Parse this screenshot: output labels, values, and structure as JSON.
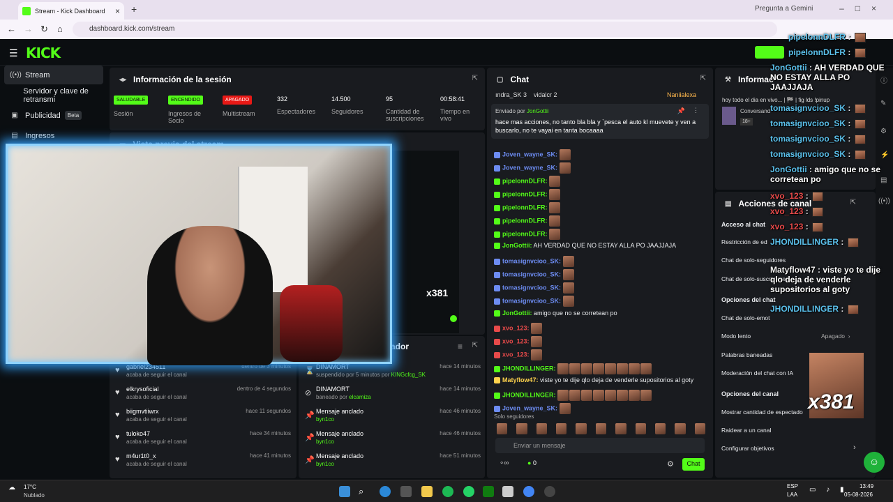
{
  "browser": {
    "tab_title": "Stream - Kick Dashboard",
    "url": "dashboard.kick.com/stream",
    "gemini": "Pregunta a Gemini"
  },
  "kick": {
    "logo": "KICK"
  },
  "sidebar": {
    "items": [
      {
        "label": "Stream",
        "icon": "broadcast-icon"
      },
      {
        "label": "Servidor y clave de retransmi",
        "icon": ""
      },
      {
        "label": "Publicidad",
        "icon": "megaphone-icon",
        "badge": "Beta"
      },
      {
        "label": "Ingresos",
        "icon": "bars-icon"
      }
    ]
  },
  "session": {
    "title": "Información de la sesión",
    "stats": [
      {
        "badge": "SALUDABLE",
        "label": "Sesión"
      },
      {
        "badge": "ENCENDIDO",
        "label": "Ingresos de Socio"
      },
      {
        "badge": "APAGADO",
        "label": "Multistream"
      },
      {
        "value": "332",
        "label": "Espectadores"
      },
      {
        "value": "14.500",
        "label": "Seguidores"
      },
      {
        "value": "95",
        "label": "Cantidad de suscripciones"
      },
      {
        "value": "00:58:41",
        "label": "Tiempo en vivo"
      }
    ]
  },
  "preview": {
    "title": "Vista previa del stream",
    "overlay_text": "x381"
  },
  "followers": [
    {
      "name": "gabriel234511",
      "sub": "acaba de seguir el canal",
      "time": "dentro de 3 minutos"
    },
    {
      "name": "elkrysoficial",
      "sub": "acaba de seguir el canal",
      "time": "dentro de 4 segundos"
    },
    {
      "name": "biigmvtiiwrx",
      "sub": "acaba de seguir el canal",
      "time": "hace 11 segundos"
    },
    {
      "name": "tuloko47",
      "sub": "acaba de seguir el canal",
      "time": "hace 34 minutos"
    },
    {
      "name": "m4ur1t0_x",
      "sub": "acaba de seguir el canal",
      "time": "hace 41 minutos"
    }
  ],
  "moderation": {
    "title_partial": "ador",
    "items": [
      {
        "name": "DINAMORT",
        "sub": "suspendido por 5 minutos por",
        "by": "KINGcfcg_SK",
        "time": "hace 14 minutos"
      },
      {
        "name": "DINAMORT",
        "sub": "baneado por",
        "by": "elcamiza",
        "time": "hace 14 minutos"
      },
      {
        "name": "Mensaje anclado",
        "sub": "",
        "by": "byn1co",
        "time": "hace 46 minutos"
      },
      {
        "name": "Mensaje anclado",
        "sub": "",
        "by": "byn1co",
        "time": "hace 46 minutos"
      },
      {
        "name": "Mensaje anclado",
        "sub": "",
        "by": "byn1co",
        "time": "hace 51 minutos"
      }
    ]
  },
  "chat": {
    "title": "Chat",
    "top_users": [
      "ındra_SK 3",
      "vidalcr 2",
      "Naniialexa"
    ],
    "pinned_by_label": "Enviado por",
    "pinned_user": "JonGottii",
    "pinned_text": "hace mas acciones, no tanto bla bla y `pesca el auto kl muevete y ven a buscarlo, no te vayai en tanta bocaaaa",
    "messages": [
      {
        "user": "Joven_wayne_SK:",
        "text": "",
        "color": "#6d8cf2"
      },
      {
        "user": "Joven_wayne_SK:",
        "text": "",
        "color": "#6d8cf2"
      },
      {
        "user": "pipelonnDLFR:",
        "text": "",
        "color": "#53fc18"
      },
      {
        "user": "pipelonnDLFR:",
        "text": "",
        "color": "#53fc18"
      },
      {
        "user": "pipelonnDLFR:",
        "text": "",
        "color": "#53fc18"
      },
      {
        "user": "pipelonnDLFR:",
        "text": "",
        "color": "#53fc18"
      },
      {
        "user": "pipelonnDLFR:",
        "text": "",
        "color": "#53fc18"
      },
      {
        "user": "JonGottii:",
        "text": "AH VERDAD QUE NO ESTAY ALLA PO JAAJJAJA",
        "color": "#53fc18"
      },
      {
        "user": "tomasignvcioo_SK:",
        "text": "",
        "color": "#6d8cf2"
      },
      {
        "user": "tomasignvcioo_SK:",
        "text": "",
        "color": "#6d8cf2"
      },
      {
        "user": "tomasignvcioo_SK:",
        "text": "",
        "color": "#6d8cf2"
      },
      {
        "user": "tomasignvcioo_SK:",
        "text": "",
        "color": "#6d8cf2"
      },
      {
        "user": "JonGottii:",
        "text": "amigo que no se corretean po",
        "color": "#53fc18"
      },
      {
        "user": "xvo_123:",
        "text": "",
        "color": "#e84a4a"
      },
      {
        "user": "xvo_123:",
        "text": "",
        "color": "#e84a4a"
      },
      {
        "user": "xvo_123:",
        "text": "",
        "color": "#e84a4a"
      },
      {
        "user": "JHONDILLINGER:",
        "text": "",
        "color": "#53fc18"
      },
      {
        "user": "Matyflow47:",
        "text": "viste yo te dije qlo deja de venderle supositorios al goty",
        "color": "#ffd34d"
      },
      {
        "user": "JHONDILLINGER:",
        "text": "",
        "color": "#53fc18"
      },
      {
        "user": "Joven_wayne_SK:",
        "text": "",
        "color": "#6d8cf2"
      }
    ],
    "emote_row_label": "Solo seguidores",
    "input_placeholder": "Enviar un mensaje",
    "count": "0",
    "send_label": "Chat"
  },
  "right": {
    "info_title": "Informac",
    "stream_title": "hoy todo el dia en vivo... | 🏁 | fig lds !pinup",
    "category": "Conversand",
    "age_badge": "18+",
    "actions_title": "Acciones de canal",
    "access_label": "Acceso al chat",
    "rows": [
      "Restricción de ed",
      "Chat de solo-seguidores",
      "Chat de solo-suscriptores"
    ],
    "chat_options_title": "Opciones del chat",
    "chat_rows": [
      "Chat de solo-emot",
      "Modo lento",
      "Palabras baneadas",
      "Moderación del chat con IA"
    ],
    "slow_mode_value": "Apagado",
    "channel_options_title": "Opciones del canal",
    "channel_rows": [
      "Mostrar cantidad de espectado",
      "Raidear a un canal",
      "Configurar objetivos"
    ]
  },
  "overlay_chat": [
    {
      "user": "pipelonnDLFR",
      "text": ""
    },
    {
      "user": "pipelonnDLFR",
      "text": ""
    },
    {
      "user": "JonGottii",
      "text": "AH VERDAD QUE NO ESTAY ALLA PO JAAJJAJA"
    },
    {
      "user": "tomasignvcioo_SK",
      "text": ""
    },
    {
      "user": "tomasignvcioo_SK",
      "text": ""
    },
    {
      "user": "tomasignvcioo_SK",
      "text": ""
    },
    {
      "user": "tomasignvcioo_SK",
      "text": ""
    },
    {
      "user": "JonGottii",
      "text": "amigo que no se corretean po"
    },
    {
      "user": "xvo_123",
      "text": ""
    },
    {
      "user": "xvo_123",
      "text": ""
    },
    {
      "user": "xvo_123",
      "text": ""
    },
    {
      "user": "JHONDILLINGER",
      "text": ""
    },
    {
      "user": "Matyflow47",
      "text": "viste yo te dije qlo deja de venderle supositorios al goty"
    },
    {
      "user": "JHONDILLINGER",
      "text": ""
    }
  ],
  "overlay_counter": "x381",
  "taskbar": {
    "weather_temp": "17°C",
    "weather_desc": "Nublado",
    "lang": "ESP",
    "lang2": "LAA",
    "time": "13:49",
    "date": "05-08-2026"
  }
}
